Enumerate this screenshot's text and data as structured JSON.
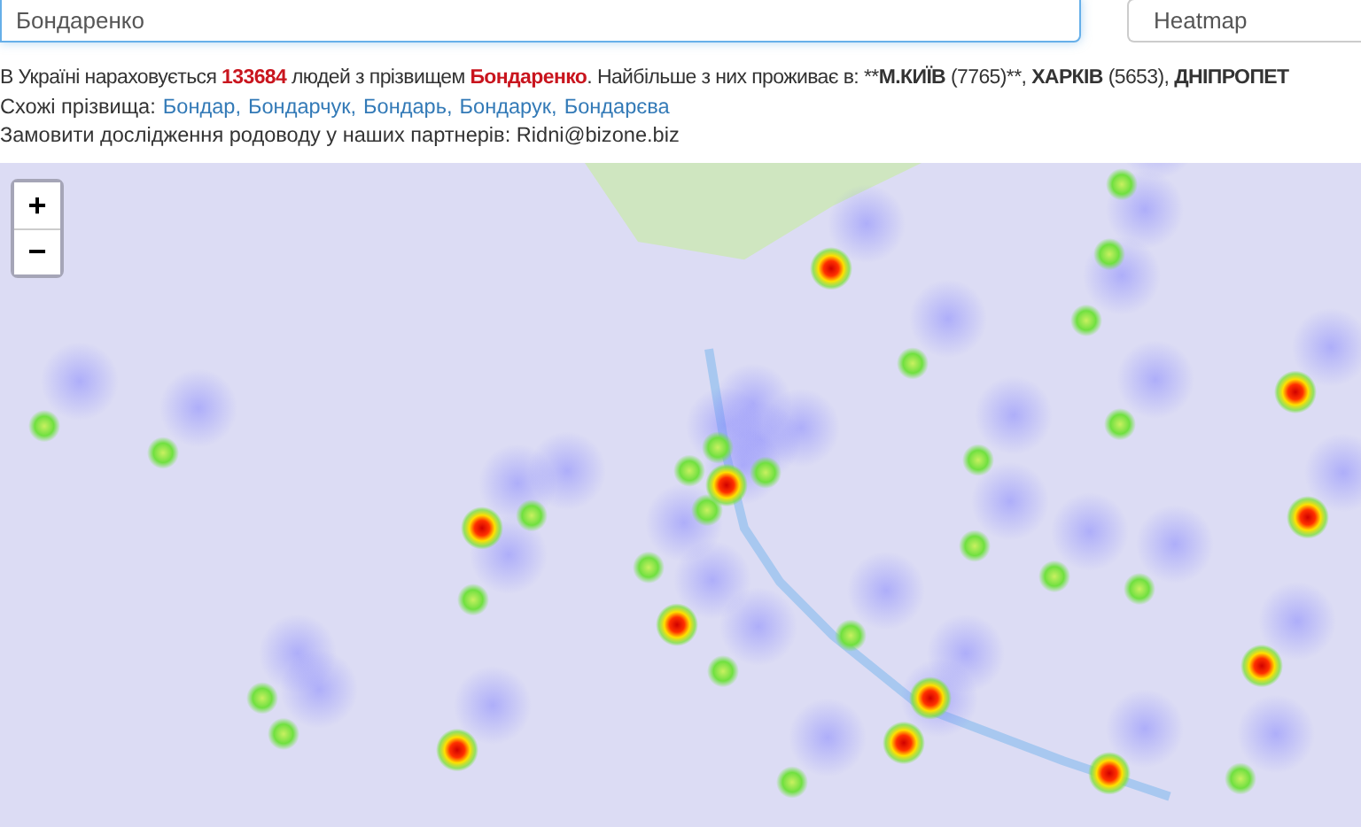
{
  "search": {
    "value": "Бондаренко"
  },
  "layer_select": {
    "value": "Heatmap"
  },
  "summary": [
    {
      "kind": "plain",
      "text": "В Україні нараховується "
    },
    {
      "kind": "highlight",
      "text": "133684"
    },
    {
      "kind": "plain",
      "text": " людей з прізвищем "
    },
    {
      "kind": "highlight",
      "text": "Бондаренко"
    },
    {
      "kind": "plain",
      "text": ". Найбільше з них проживає в: **"
    },
    {
      "kind": "bold",
      "text": "М.КИЇВ"
    },
    {
      "kind": "plain",
      "text": " (7765)**, "
    },
    {
      "kind": "bold",
      "text": "ХАРКІВ"
    },
    {
      "kind": "plain",
      "text": " (5653), "
    },
    {
      "kind": "bold",
      "text": "ДНІПРОПЕТ"
    }
  ],
  "similar": {
    "label": "Схожі прізвища:",
    "links": [
      "Бондар,",
      "Бондарчук,",
      "Бондарь,",
      "Бондарук,",
      "Бондарєва"
    ]
  },
  "order_note": "Замовити дослідження родоводу у наших партнерів: Ridni@bizone.biz",
  "map": {
    "zoom_in": "+",
    "zoom_out": "−"
  }
}
